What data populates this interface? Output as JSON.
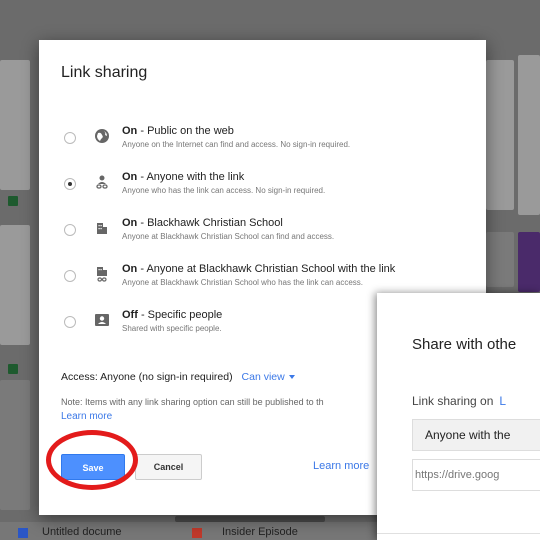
{
  "dialog": {
    "title": "Link sharing",
    "options": [
      {
        "icon": "globe-icon",
        "state": "On",
        "title": "Public on the web",
        "desc": "Anyone on the Internet can find and access. No sign-in required.",
        "selected": false
      },
      {
        "icon": "link-person-icon",
        "state": "On",
        "title": "Anyone with the link",
        "desc": "Anyone who has the link can access. No sign-in required.",
        "selected": true
      },
      {
        "icon": "building-icon",
        "state": "On",
        "title": "Blackhawk Christian School",
        "desc": "Anyone at Blackhawk Christian School can find and access.",
        "selected": false
      },
      {
        "icon": "building-link-icon",
        "state": "On",
        "title": "Anyone at Blackhawk Christian School with the link",
        "desc": "Anyone at Blackhawk Christian School who has the link can access.",
        "selected": false
      },
      {
        "icon": "person-icon",
        "state": "Off",
        "title": "Specific people",
        "desc": "Shared with specific people.",
        "selected": false
      }
    ],
    "separator": " - ",
    "access_label": "Access:",
    "access_value": "Anyone (no sign-in required)",
    "can_view": "Can view",
    "note": "Note: Items with any link sharing option can still be published to th",
    "learn_more_inline": "Learn more",
    "save": "Save",
    "cancel": "Cancel",
    "learn_more_bottom": "Learn more"
  },
  "share_panel": {
    "title": "Share with othe",
    "link_sharing_label": "Link sharing on",
    "link_sharing_link": "L",
    "access_select": "Anyone with the",
    "url": "https://drive.goog"
  },
  "background": {
    "bottom_labels": [
      "Untitled docume",
      "Insider Episode"
    ]
  },
  "colors": {
    "accent": "#4d90fe",
    "link": "#3b78e7",
    "annotation_circle": "#e31b1b"
  }
}
